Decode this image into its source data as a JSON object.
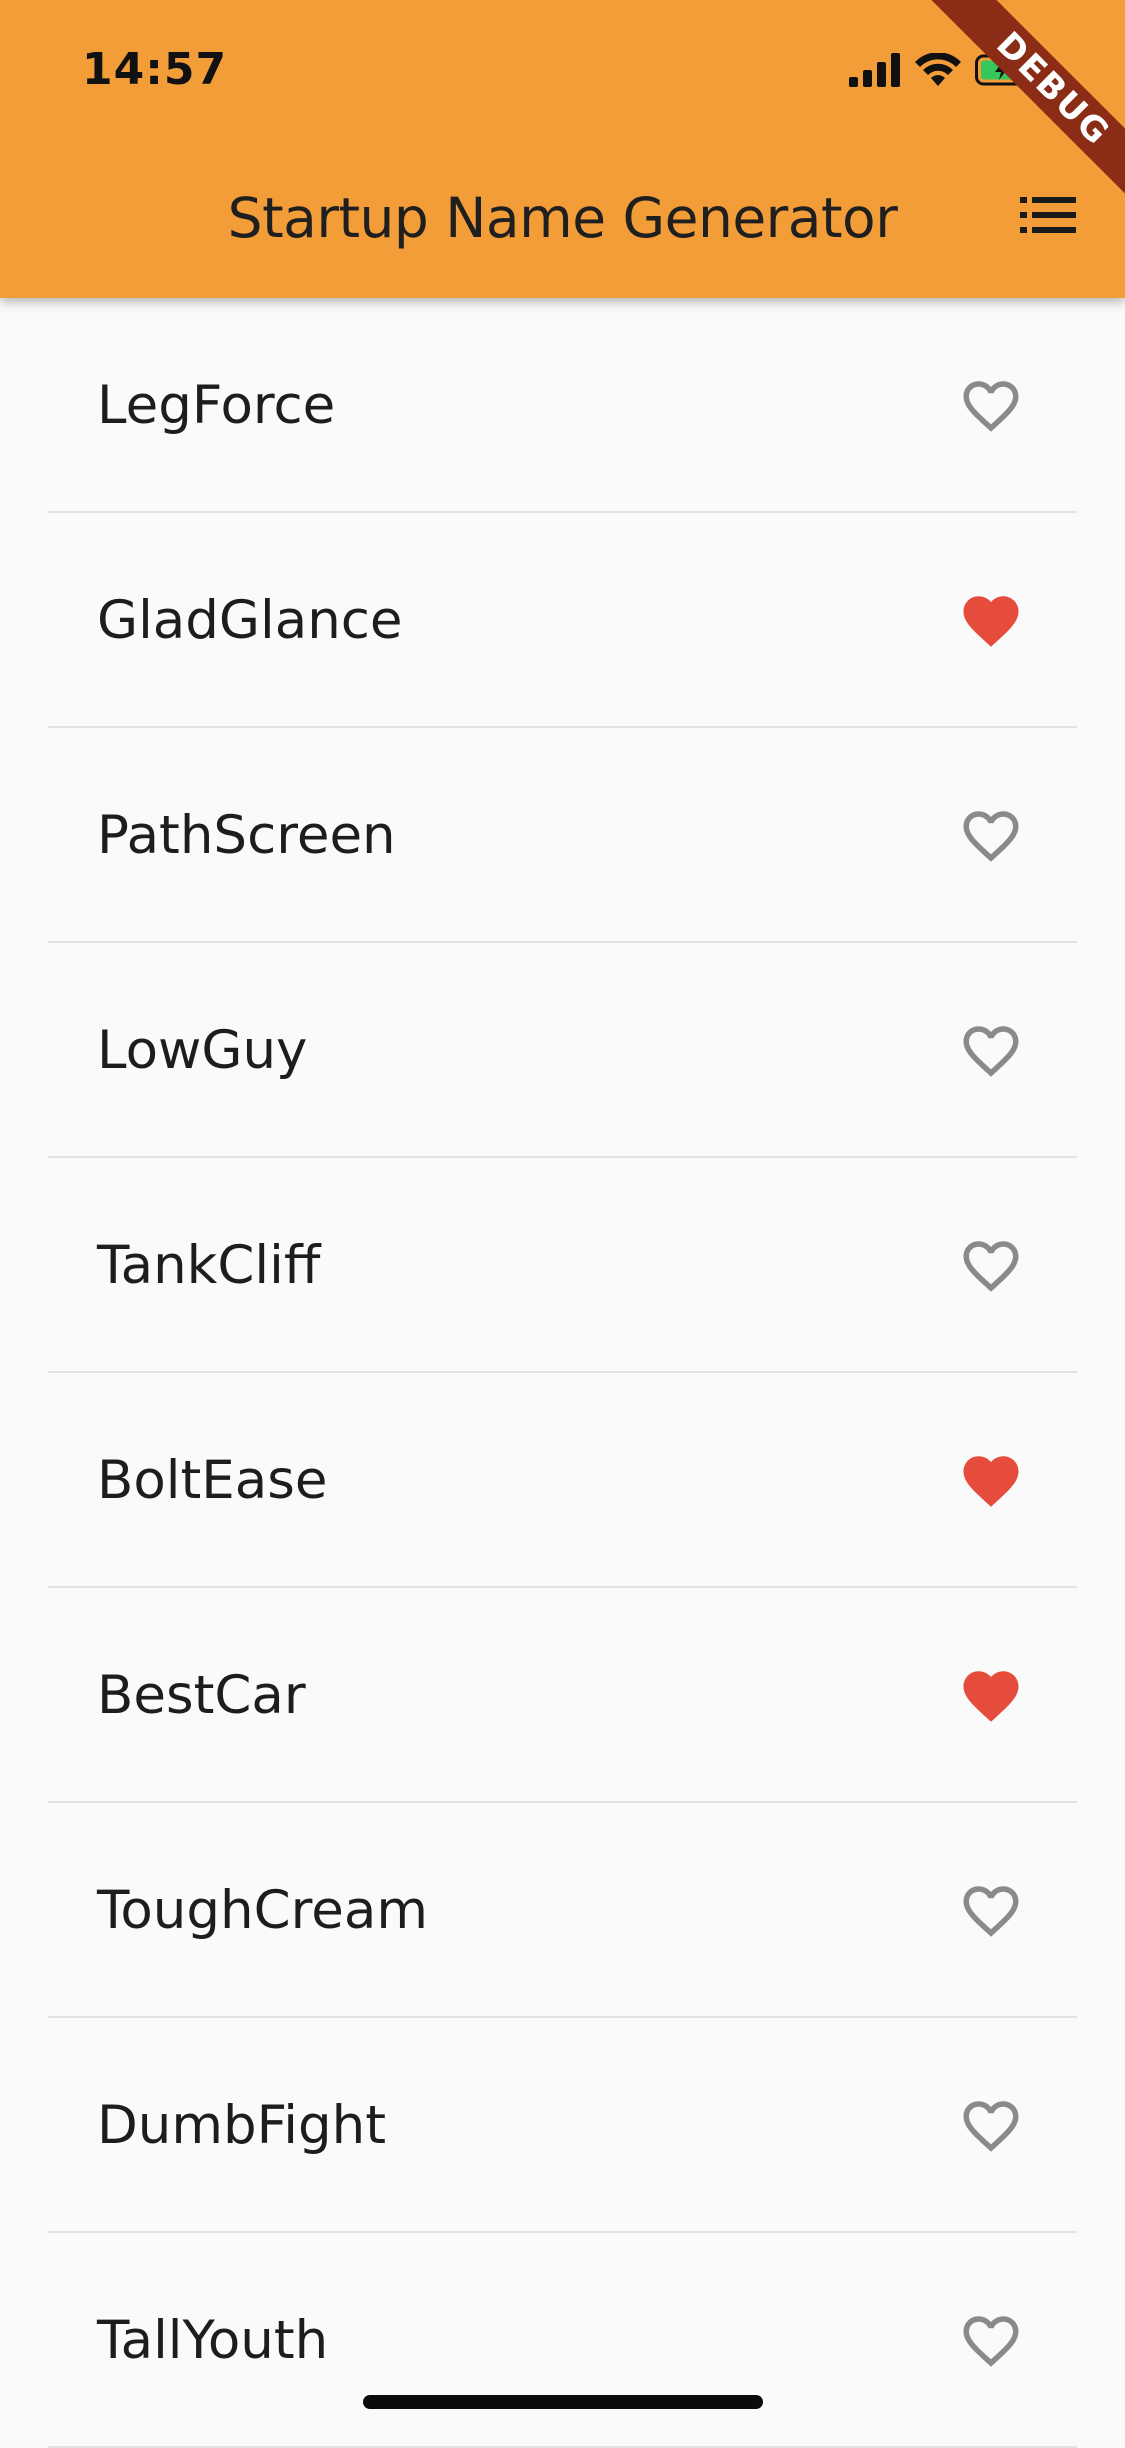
{
  "status_bar": {
    "time": "14:57",
    "icons": [
      "cellular-signal-icon",
      "wifi-icon",
      "battery-charging-icon"
    ]
  },
  "app_bar": {
    "title": "Startup Name Generator",
    "action_icon": "list-icon",
    "background": "#f39d38",
    "debug_banner": "DEBUG"
  },
  "colors": {
    "favorite": "#e64c3c",
    "unfavorite": "#8a8a8a",
    "divider": "#e2e2e2"
  },
  "suggestions": [
    {
      "name": "LegForce",
      "saved": false
    },
    {
      "name": "GladGlance",
      "saved": true
    },
    {
      "name": "PathScreen",
      "saved": false
    },
    {
      "name": "LowGuy",
      "saved": false
    },
    {
      "name": "TankCliff",
      "saved": false
    },
    {
      "name": "BoltEase",
      "saved": true
    },
    {
      "name": "BestCar",
      "saved": true
    },
    {
      "name": "ToughCream",
      "saved": false
    },
    {
      "name": "DumbFight",
      "saved": false
    },
    {
      "name": "TallYouth",
      "saved": false
    }
  ]
}
